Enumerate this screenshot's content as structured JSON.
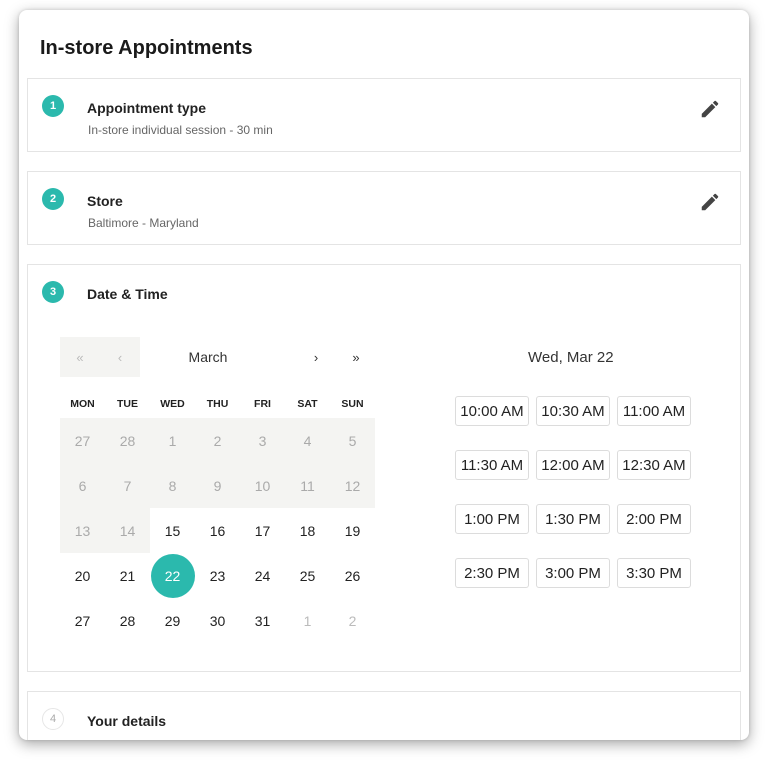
{
  "title": "In-store Appointments",
  "steps": [
    {
      "number": "1",
      "title": "Appointment type",
      "subtitle": "In-store individual session - 30 min"
    },
    {
      "number": "2",
      "title": "Store",
      "subtitle": "Baltimore - Maryland"
    },
    {
      "number": "3",
      "title": "Date & Time"
    },
    {
      "number": "4",
      "title": "Your details"
    }
  ],
  "icons": {
    "edit": "pencil-icon"
  },
  "colors": {
    "accent": "#2bb9ad",
    "muted_bg": "#f4f4f2"
  },
  "calendar": {
    "month": "March",
    "nav": {
      "prev_year": "«",
      "prev": "‹",
      "next": "›",
      "next_year": "»"
    },
    "weekdays": [
      "MON",
      "TUE",
      "WED",
      "THU",
      "FRI",
      "SAT",
      "SUN"
    ],
    "weeks": [
      [
        {
          "d": "27",
          "s": "muted"
        },
        {
          "d": "28",
          "s": "muted"
        },
        {
          "d": "1",
          "s": "muted"
        },
        {
          "d": "2",
          "s": "muted"
        },
        {
          "d": "3",
          "s": "muted"
        },
        {
          "d": "4",
          "s": "muted"
        },
        {
          "d": "5",
          "s": "muted"
        }
      ],
      [
        {
          "d": "6",
          "s": "muted"
        },
        {
          "d": "7",
          "s": "muted"
        },
        {
          "d": "8",
          "s": "muted"
        },
        {
          "d": "9",
          "s": "muted"
        },
        {
          "d": "10",
          "s": "muted"
        },
        {
          "d": "11",
          "s": "muted"
        },
        {
          "d": "12",
          "s": "muted"
        }
      ],
      [
        {
          "d": "13",
          "s": "muted"
        },
        {
          "d": "14",
          "s": "muted"
        },
        {
          "d": "15",
          "s": "available"
        },
        {
          "d": "16",
          "s": "available"
        },
        {
          "d": "17",
          "s": "available"
        },
        {
          "d": "18",
          "s": "available"
        },
        {
          "d": "19",
          "s": "available"
        }
      ],
      [
        {
          "d": "20",
          "s": "available"
        },
        {
          "d": "21",
          "s": "available"
        },
        {
          "d": "22",
          "s": "selected"
        },
        {
          "d": "23",
          "s": "available"
        },
        {
          "d": "24",
          "s": "available"
        },
        {
          "d": "25",
          "s": "available"
        },
        {
          "d": "26",
          "s": "available"
        }
      ],
      [
        {
          "d": "27",
          "s": "available"
        },
        {
          "d": "28",
          "s": "available"
        },
        {
          "d": "29",
          "s": "available"
        },
        {
          "d": "30",
          "s": "available"
        },
        {
          "d": "31",
          "s": "available"
        },
        {
          "d": "1",
          "s": "outside"
        },
        {
          "d": "2",
          "s": "outside"
        }
      ]
    ]
  },
  "time": {
    "heading": "Wed, Mar 22",
    "slots": [
      "10:00 AM",
      "10:30 AM",
      "11:00 AM",
      "11:30 AM",
      "12:00 AM",
      "12:30 AM",
      "1:00 PM",
      "1:30 PM",
      "2:00 PM",
      "2:30 PM",
      "3:00 PM",
      "3:30 PM"
    ]
  }
}
